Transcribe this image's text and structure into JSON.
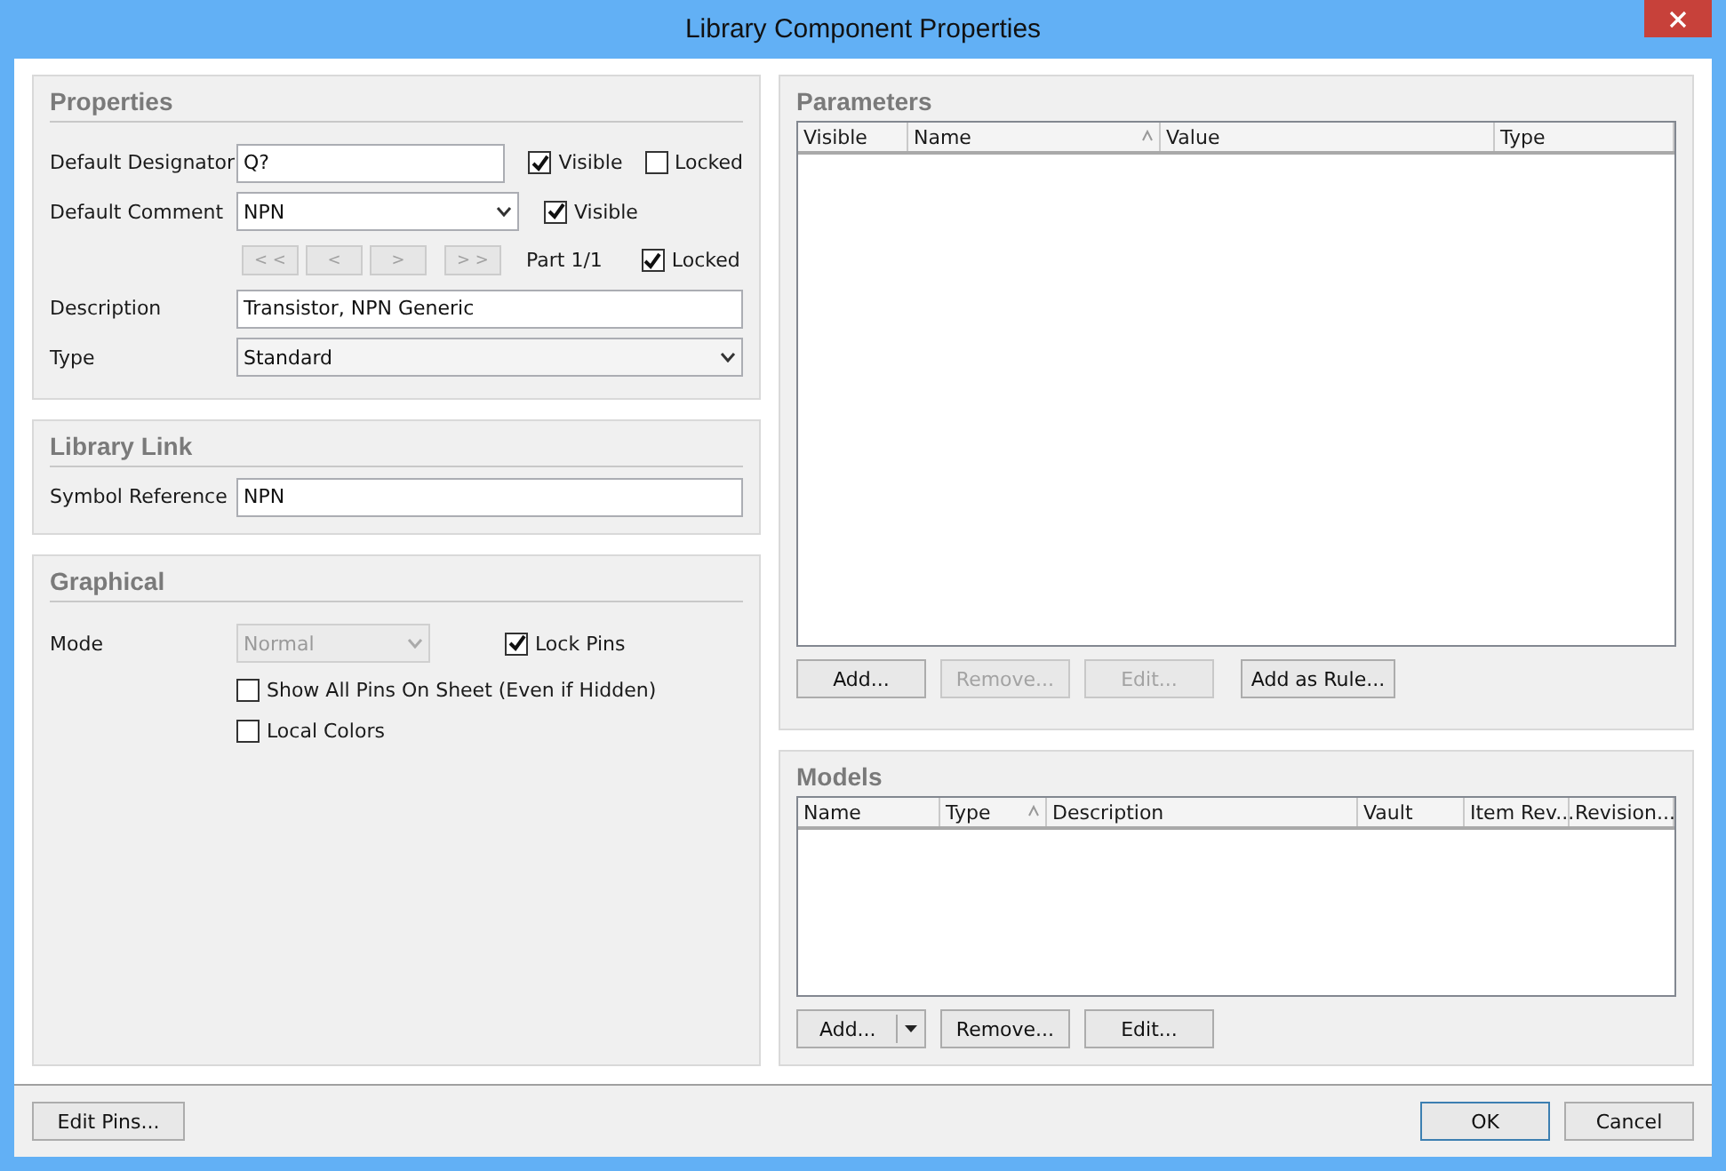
{
  "window": {
    "title": "Library Component Properties"
  },
  "properties": {
    "title": "Properties",
    "designator": {
      "label": "Default Designator",
      "value": "Q?",
      "visible": {
        "label": "Visible",
        "checked": true
      },
      "locked": {
        "label": "Locked",
        "checked": false
      }
    },
    "comment": {
      "label": "Default Comment",
      "value": "NPN",
      "visible": {
        "label": "Visible",
        "checked": true
      }
    },
    "part_nav": [
      {
        "label": "< <",
        "disabled": true
      },
      {
        "label": "<",
        "disabled": true
      },
      {
        "label": ">",
        "disabled": true
      },
      {
        "label": "> >",
        "disabled": true
      }
    ],
    "part": "Part 1/1",
    "part_locked": {
      "label": "Locked",
      "checked": true
    },
    "description": {
      "label": "Description",
      "value": "Transistor, NPN Generic"
    },
    "type": {
      "label": "Type",
      "value": "Standard"
    }
  },
  "library_link": {
    "title": "Library Link",
    "symbol_reference": {
      "label": "Symbol Reference",
      "value": "NPN"
    }
  },
  "graphical": {
    "title": "Graphical",
    "mode": {
      "label": "Mode",
      "value": "Normal",
      "disabled": true
    },
    "lock_pins": {
      "label": "Lock Pins",
      "checked": true
    },
    "show_all_pins": {
      "label": "Show All Pins On Sheet (Even if Hidden)",
      "checked": false
    },
    "local_colors": {
      "label": "Local Colors",
      "checked": false
    }
  },
  "parameters": {
    "title": "Parameters",
    "columns": [
      {
        "label": "Visible",
        "sorted": false
      },
      {
        "label": "Name",
        "sorted": true
      },
      {
        "label": "Value",
        "sorted": false
      },
      {
        "label": "Type",
        "sorted": false
      }
    ],
    "buttons": [
      {
        "label": "Add...",
        "disabled": false
      },
      {
        "label": "Remove...",
        "disabled": true
      },
      {
        "label": "Edit...",
        "disabled": true
      },
      {
        "label": "Add as Rule...",
        "disabled": false
      }
    ]
  },
  "models": {
    "title": "Models",
    "columns": [
      {
        "label": "Name",
        "sorted": false
      },
      {
        "label": "Type",
        "sorted": true
      },
      {
        "label": "Description",
        "sorted": false
      },
      {
        "label": "Vault",
        "sorted": false
      },
      {
        "label": "Item Rev...",
        "sorted": false
      },
      {
        "label": "Revision...",
        "sorted": false
      }
    ],
    "buttons": [
      {
        "label": "Add...",
        "kind": "split"
      },
      {
        "label": "Remove...",
        "kind": "plain"
      },
      {
        "label": "Edit...",
        "kind": "plain"
      }
    ]
  },
  "footer": {
    "edit_pins": "Edit Pins...",
    "ok": "OK",
    "cancel": "Cancel"
  }
}
